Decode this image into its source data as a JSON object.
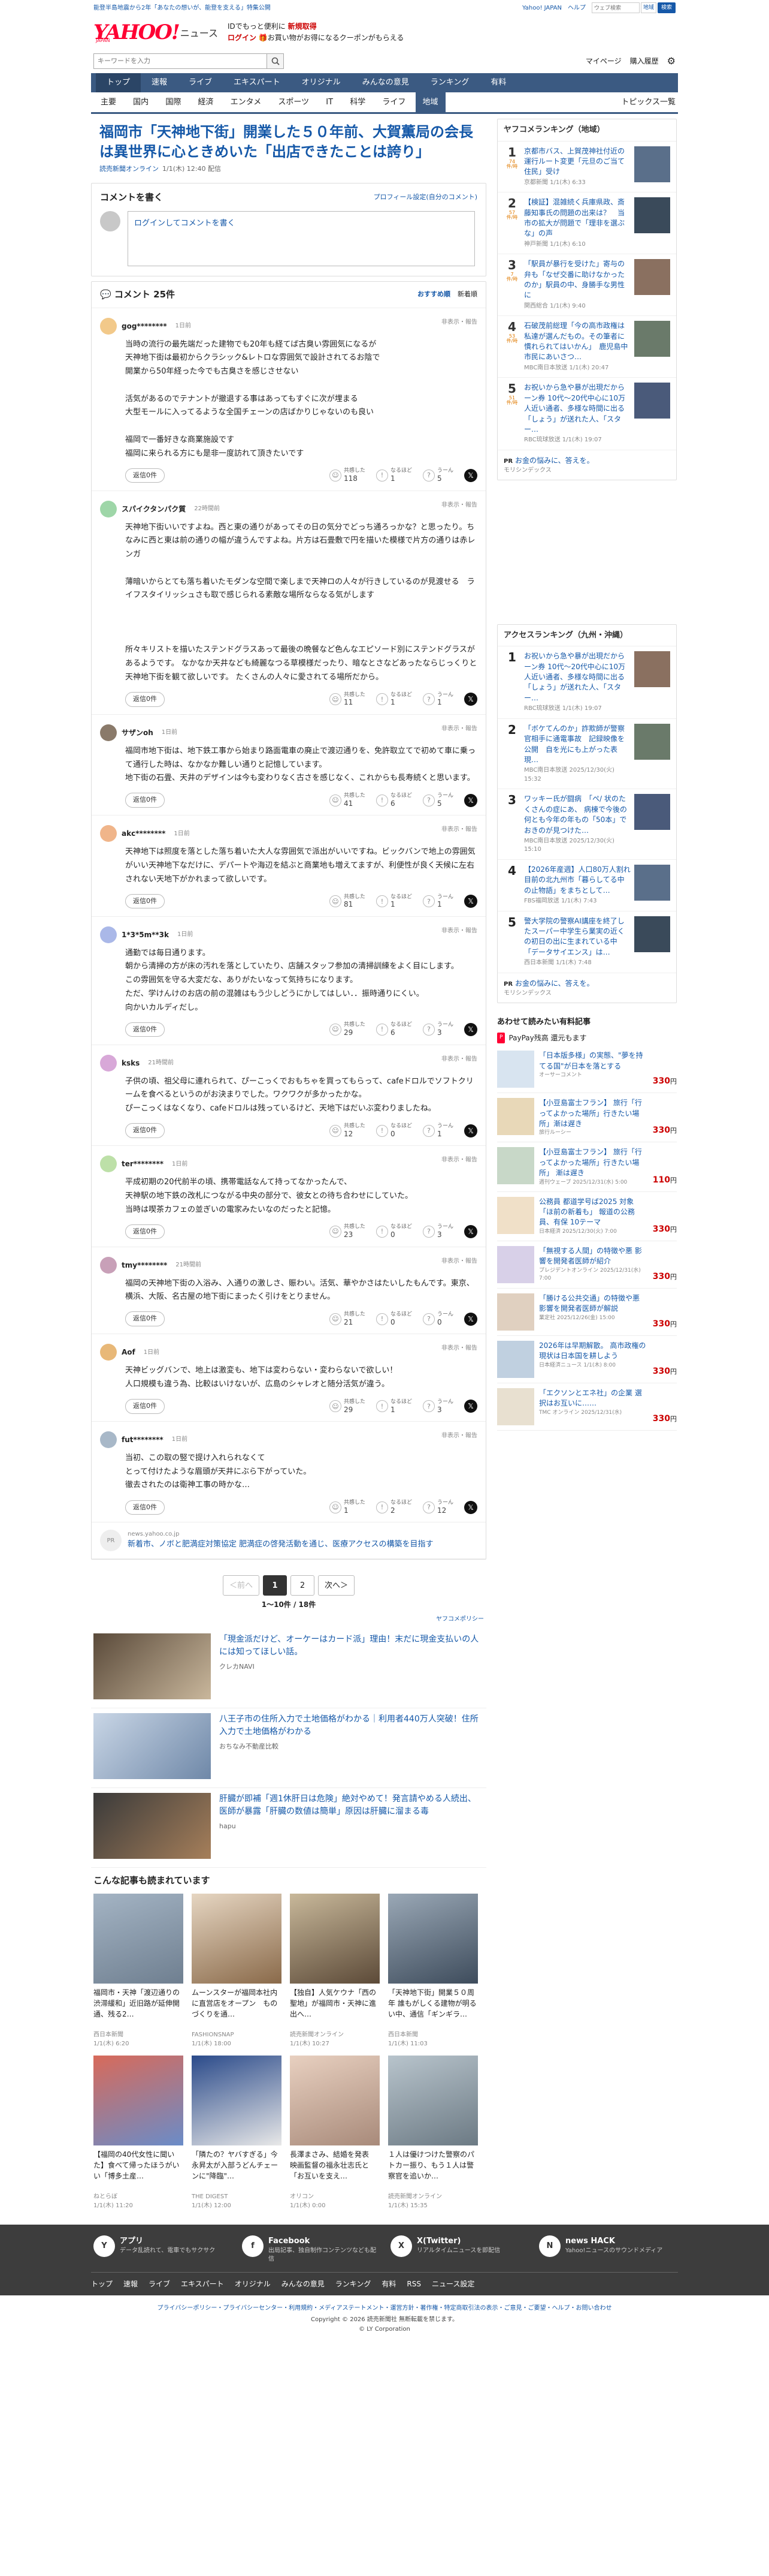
{
  "topbar": {
    "promo": "能登半島地震から2年「あなたの想いが、能登を支える」特集公開",
    "jp": "Yahoo! JAPAN",
    "help": "ヘルプ",
    "search_ph": "ウェブ検索",
    "region": "地域",
    "search_btn": "検索"
  },
  "header": {
    "logo": "YAHOO!",
    "japan": "JAPAN",
    "news": "ニュース",
    "line1": "IDでもっと便利に",
    "new_reg": "新規取得",
    "login": "ログイン",
    "line2": "お買い物がお得になるクーポンがもらえる",
    "search_ph": "キーワードを入力",
    "mypage": "マイページ",
    "purchase": "購入履歴"
  },
  "gnav": [
    "トップ",
    "速報",
    "ライブ",
    "エキスパート",
    "オリジナル",
    "みんなの意見",
    "ランキング",
    "有料"
  ],
  "subnav": [
    "主要",
    "国内",
    "国際",
    "経済",
    "エンタメ",
    "スポーツ",
    "IT",
    "科学",
    "ライフ",
    "地域"
  ],
  "subnav_right": "トピックス一覧",
  "article": {
    "title": "福岡市「天神地下街」開業した５０年前、大賀薫局の会長は異世界に心ときめいた「出店できたことは誇り」",
    "source": "読売新聞オンライン",
    "date": "1/1(木) 12:40 配信"
  },
  "form": {
    "title": "コメントを書く",
    "profile": "プロフィール設定(自分のコメント)",
    "login": "ログインしてコメントを書く"
  },
  "comments": {
    "title": "コメント 25件",
    "sort_rec": "おすすめ順",
    "sort_new": "新着順",
    "report": "非表示・報告",
    "reply": "返信0件",
    "l1": "共感した",
    "l2": "なるほど",
    "l3": "うーん",
    "items": [
      {
        "user": "gog********",
        "time": "1日前",
        "body": "当時の流行の最先端だった建物でも20年も経てば古臭い雰囲気になるが\n天神地下街は最初からクラシック&レトロな雰囲気で設計されてるお陰で\n開業から50年経った今でも古臭さを感じさせない\n\n活気があるのでテナントが撤退する事はあってもすぐに次が埋まる\n大型モールに入ってるような全国チェーンの店ばかりじゃないのも良い\n\n福岡で一番好きな商業施設です\n福岡に来られる方にも是非一度訪れて頂きたいです",
        "a": "118",
        "b": "1",
        "c": "5"
      },
      {
        "user": "スパイクタンパク質",
        "time": "22時間前",
        "body": "天神地下街いいですよね。西と東の通りがあってその日の気分でどっち通ろっかな？と思ったり。ちなみに西と東は前の通りの幅が違うんですよね。片方は石畳敷で円を描いた模様で片方の通りは赤レンガ\n\n薄暗いからとても落ち着いたモダンな空間で楽しまで天神ロの人々が行きしているのが見渡せる　ライフスタイリッシュさも取で感じられる素敵な場所ならなる気がします\n\n\n\n所々キリストを描いたステンドグラスあって最後の晩餐など色んなエピソード別にステンドグラスがあるようです。 なかなか天井なども綺麗なつる草模様だったり、暗なとさなどあったならじっくりと天神地下街を観て欲しいです。 たくさんの人々に愛されてる場所だから。",
        "a": "11",
        "b": "1",
        "c": "1"
      },
      {
        "user": "サザンoh",
        "time": "1日前",
        "body": "福岡市地下街は、地下鉄工事から始まり路面電車の廃止で渡辺通りを、免許取立てで初めて車に乗って通行した時は、なかなか難しい通りと記憶しています。\n地下街の石畳、天井のデザインは今も変わりなく古さを感じなく、これからも長寿続くと思います。",
        "a": "41",
        "b": "6",
        "c": "5"
      },
      {
        "user": "akc********",
        "time": "1日前",
        "body": "天神地下は照度を落とした落ち着いた大人な雰囲気で派出がいいですね。ビックバンで地上の雰囲気がいい天神地下なだけに、デパートや海辺を結ぶと商業地も増えてますが、利便性が良く天候に左右されない天地下がかれまって欲しいです。",
        "a": "81",
        "b": "1",
        "c": "1"
      },
      {
        "user": "1*3*5m**3k",
        "time": "1日前",
        "body": "通勤では毎日通ります。\n朝から清掃の方が床の汚れを落としていたり、店舗スタッフ参加の清掃訓練をよく目にします。\nこの雰囲気を守る大変だな、ありがたいなって気持ちになります。\nただ、学けんけのお店の前の混雑はもう少しどうにかしてはしい．．振時通りにくい。\n向かいカルディだし。",
        "a": "29",
        "b": "6",
        "c": "3"
      },
      {
        "user": "ksks",
        "time": "21時間前",
        "body": "子供の頃、祖父母に連れられて、ぴーこっくでおもちゃを買ってもらって、cafeドロルでソフトクリームを食べるというのがお決まりでした。ワクワクが多かったかな。\nぴーこっくはなくなり、cafeドロルは残っているけど、天地下はだいぶ変わりましたね。",
        "a": "12",
        "b": "0",
        "c": "1"
      },
      {
        "user": "ter********",
        "time": "1日前",
        "body": "平成初期の20代前半の頃、携帯電話なんて持ってなかったんで、\n天神駅の地下鉄の改札につながる中央の部分で、彼女との待ち合わせにしていた。\n当時は喫茶カフェの並ぎいの電家みたいなのだったと記憶。",
        "a": "23",
        "b": "0",
        "c": "3"
      },
      {
        "user": "tmy********",
        "time": "21時間前",
        "body": "福岡の天神地下街の入浴み、入通りの激しさ、賑わい。活気、華やかさはたいしたもんです。東京、横浜、大阪、名古屋の地下街にまったく引けをとりません。",
        "a": "21",
        "b": "0",
        "c": "0"
      },
      {
        "user": "Aof",
        "time": "1日前",
        "body": "天神ビッグバンで、地上は激変も、地下は変わらない・変わらないで欲しい！\n人口規模も違う為、比較はいけないが、広島のシャレオと随分活気が違う。",
        "a": "29",
        "b": "1",
        "c": "3"
      },
      {
        "user": "fut********",
        "time": "1日前",
        "body": "当初、この取の竪で提け入れられなくて\nとって付けたような眉頭が天井にぶら下がっていた。\n徹去されたのは衛神工事の時かな…",
        "a": "1",
        "b": "2",
        "c": "12"
      }
    ]
  },
  "adrow": {
    "src": "news.yahoo.co.jp",
    "title": "新着市、ノボと肥満症対策協定 肥満症の啓発活動を通じ、医療アクセスの構築を目指す"
  },
  "pager": {
    "prev": "＜前へ",
    "p1": "1",
    "p2": "2",
    "next": "次へ＞",
    "info": "1〜10件 / 18件"
  },
  "yads": "ヤフコメポリシー",
  "news_list": [
    {
      "title": "「現金派だけど、オーケーはカード派」理由！末だに現金支払いの人には知ってほしい話。",
      "src": "クレカNAVI"
    },
    {
      "title": "八王子市の住所入力で土地価格がわかる｜利用者440万人突破！住所入力で土地価格がわかる",
      "src": "おちなみ不動産比較"
    },
    {
      "title": "肝臓が即補「週1休肝日は危険」絶対やめて！発言請やめる人続出、医師が暴露「肝臓の数値は簡単」原因は肝臓に溜まる毒",
      "src": "hapu"
    }
  ],
  "rec": {
    "title": "こんな記事も読まれています",
    "items": [
      {
        "t": "福岡市・天神「渡辺通りの渋滞緩和」近旧路が延伸開通、残る2…",
        "s": "西日本新聞\n1/1(木) 6:20"
      },
      {
        "t": "ムーンスターが福岡本社内に直営店をオープン　ものづくりを通…",
        "s": "FASHIONSNAP\n1/1(木) 18:00"
      },
      {
        "t": "【独自】人気ケウナ「西の聖地」が福岡市・天神に進出へ…",
        "s": "読売新聞オンライン\n1/1(木) 10:27"
      },
      {
        "t": "「天神地下街」開業５０周年 誰もがしくる建物が明るい中、通信「ギンギラ…",
        "s": "西日本新聞\n1/1(木) 11:03"
      },
      {
        "t": "【福岡の40代女性に聞いた】食べて帰ったほうがいい「博多土産…",
        "s": "ねとらぼ\n1/1(木) 11:20"
      },
      {
        "t": "「隣たの？ヤバすぎる」今永昇太が入部うどんチェーンに\"降臨\"…",
        "s": "THE DIGEST\n1/1(木) 12:00"
      },
      {
        "t": "長澤まさみ、結婚を発表　映画監督の福永壮志氏と「お互いを支え…",
        "s": "オリコン\n1/1(木) 0:00"
      },
      {
        "t": "１人は優けつけた警察のパトカー振り、もう１人は警察官を追いか…",
        "s": "読売新聞オンライン\n1/1(木) 15:35"
      }
    ]
  },
  "side": {
    "rank_title": "ヤフコメランキング（地域）",
    "rank": [
      {
        "no": "1",
        "cnt": "74",
        "unit": "件/時",
        "t": "京都市バス、上賀茂神社付近の運行ルート変更「元旦のご当て住民」受け",
        "s": "京都新聞 1/1(木) 6:33"
      },
      {
        "no": "2",
        "cnt": "57",
        "unit": "件/時",
        "t": "【検証】混雑続く兵庫県政、斎藤知事氏の問題の出来は？　当市の拡大が問題で「理非を選ぶな」の声",
        "s": "神戸新聞 1/1(木) 6:10"
      },
      {
        "no": "3",
        "cnt": "7",
        "unit": "件/時",
        "t": "「駅員が暴行を受けた」寄与の弁も「なぜ交番に助けなかったのか」駅員の中、身勝手な男性に",
        "s": "関西総合 1/1(木) 9:40"
      },
      {
        "no": "4",
        "cnt": "53",
        "unit": "件/時",
        "t": "石破茂前総理「今の高市政権は私達が選んだもの。その筆者に慣れられてはいかん」　鹿児島中市民にあいさつ…",
        "s": "MBC南日本放送 1/1(木) 20:47"
      },
      {
        "no": "5",
        "cnt": "51",
        "unit": "件/時",
        "t": "お祝いから急や暴が出現だからーン券 10代〜20代中心に10万人近い通者、多様な時間に出る「しょう」が送れた人、「スター…",
        "s": "RBC琉球放送 1/1(木) 19:07"
      }
    ],
    "pr1": {
      "h": "お金の悩みに、答えを。",
      "s": "モリシンデックス"
    },
    "access_title": "アクセスランキング（九州・沖縄）",
    "access": [
      {
        "no": "1",
        "t": "お祝いから急や暴が出現だからーン券 10代〜20代中心に10万人近い通者、多様な時間に出る「しょう」が送れた人、「スター…",
        "s": "RBC琉球放送 1/1(木) 19:07"
      },
      {
        "no": "2",
        "t": "「ボケてんのか」詐欺師が警察官相手に通電事故　記録映像を公開　自を光にも上がった表現…",
        "s": "MBC南日本放送 2025/12/30(火) 15:32"
      },
      {
        "no": "3",
        "t": "ワッキー氏が闘病　「ペ/ 状のたくさんの症にあ、 病棟で今後の何とも今年の年もの「50本」でおきのが見つけた…",
        "s": "MBC南日本放送 2025/12/30(火) 15:10"
      },
      {
        "no": "4",
        "t": "【2026年産週】人口80万人割れ目前の北九州市「暮らしてる中の止物語」をまちとして…",
        "s": "FBS福岡放送 1/1(木) 7:43"
      },
      {
        "no": "5",
        "t": "警大学院の警察AI講座を終了したスーパー中学生ら業実の近くの初日の出に生まれている中「データサイエンス」は…",
        "s": "西日本新聞 1/1(木) 7:48"
      }
    ],
    "pr2": {
      "h": "お金の悩みに、答えを。",
      "s": "モリシンデックス"
    },
    "buy_title": "あわせて読みたい有料記事",
    "buy_sub": "PayPay残高 還元もます",
    "buy": [
      {
        "t": "「日本版多様」の実態、\"夢を持てる国\"が日本を落とする",
        "s": "オーサーコメント",
        "p": "330"
      },
      {
        "t": "【小豆島富士フラン】 旅行「行ってよかった場所」行きたい場所」漸は遅き",
        "s": "旅行ルーシー",
        "p": "330"
      },
      {
        "t": "【小豆島富士フラン】 旅行「行ってよかった場所」行きたい場所」 漸は遅き",
        "s": "週刊ウェーブ 2025/12/31(水) 5:00",
        "p": "110"
      },
      {
        "t": "公務員 都道学号ば2025 対象「ほ前の新着も」 報道の公務員、有保 10テーマ",
        "s": "日本経済 2025/12/30(火) 7:00",
        "p": "330"
      },
      {
        "t": "「無視する人間」の特徴や悪 影響を開発者医師が紹介",
        "s": "プレジデントオンライン 2025/12/31(水) 7:00",
        "p": "330"
      },
      {
        "t": "「勝ける公共交通」の特徴や悪 影響を開発者医師が解説",
        "s": "業定社 2025/12/26(金) 15:00",
        "p": "330"
      },
      {
        "t": "2026年は早期解散。 高市政権の現状は日本国を耕しよう",
        "s": "日本経済ニュース 1/1(木) 8:00",
        "p": "330"
      },
      {
        "t": "「エクソンとエネ社」の企業 選択はお互いに……",
        "s": "TMC オンライン 2025/12/31(水)",
        "p": "330"
      }
    ]
  },
  "footer": {
    "apps": [
      {
        "ic": "Y",
        "h": "アプリ",
        "s": "データ乱読れて、電車でもサクサク"
      },
      {
        "ic": "f",
        "h": "Facebook",
        "s": "出局記事、独自制作コンテンツなども配信"
      },
      {
        "ic": "X",
        "h": "X(Twitter)",
        "s": "リアルタイムニュースを即配信"
      },
      {
        "ic": "N",
        "h": "news HACK",
        "s": "Yahoo!ニュースのサウンドメディア"
      }
    ],
    "nav": [
      "トップ",
      "速報",
      "ライブ",
      "エキスパート",
      "オリジナル",
      "みんなの意見",
      "ランキング",
      "有料",
      "RSS",
      "ニュース設定"
    ],
    "legal": "プライバシーポリシー・プライバシーセンター・利用規約・メディアステートメント・運営方針・著作権・特定商取引法の表示・ご意見・ご要望・ヘルプ・お問い合わせ",
    "copy1": "Copyright © 2026 読売新聞社 無断転載を禁じます。",
    "copy2": "© LY Corporation"
  }
}
